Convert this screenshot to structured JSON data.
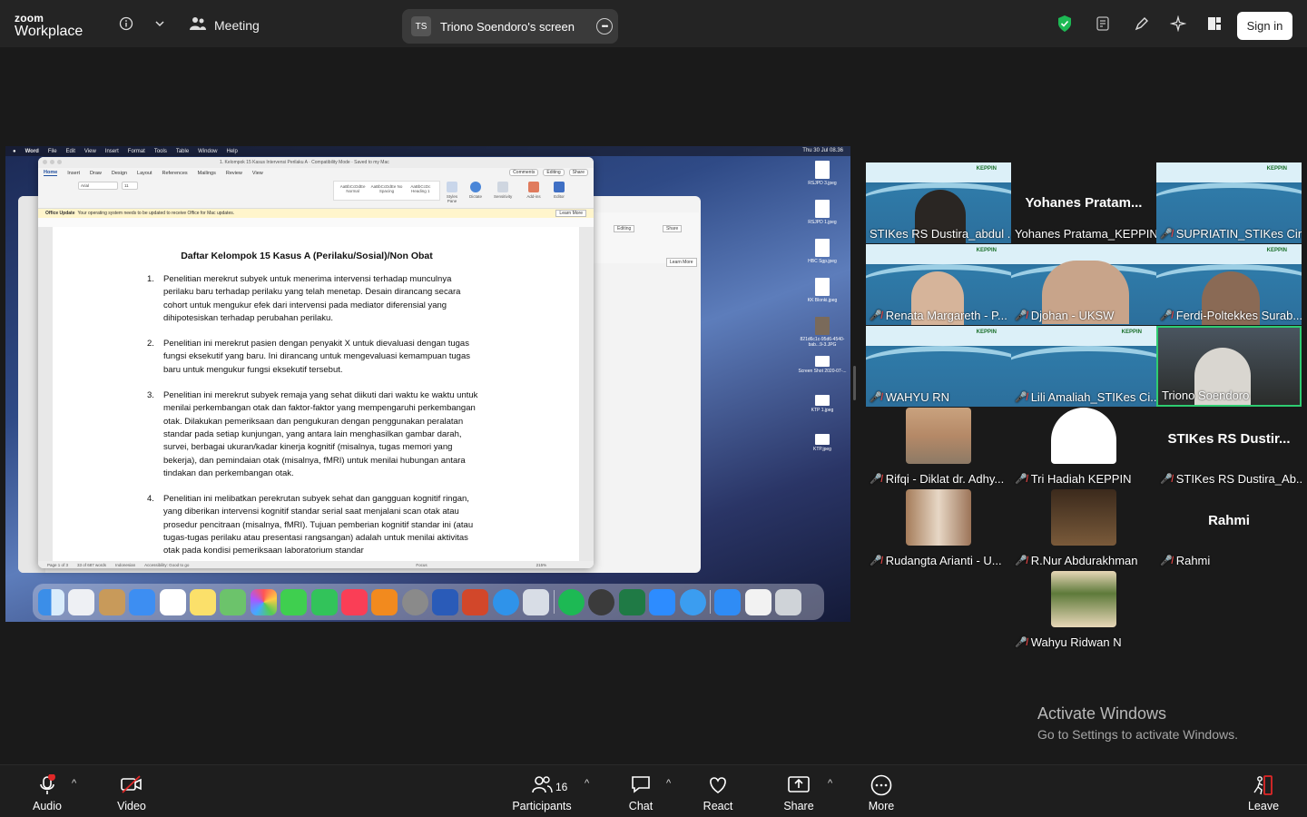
{
  "topbar": {
    "logo_line1": "zoom",
    "logo_line2": "Workplace",
    "meeting_label": "Meeting",
    "share_initials": "TS",
    "share_title": "Triono Soendoro's screen",
    "signin_label": "Sign in"
  },
  "shared_screen": {
    "menubar": [
      "Word",
      "File",
      "Edit",
      "View",
      "Insert",
      "Format",
      "Tools",
      "Table",
      "Window",
      "Help"
    ],
    "clock": "Thu 30 Jul  08.36",
    "word": {
      "doc_title_bar": "1. Kelompok 15 Kasus Intervensi Perilaku A  ·  Compatibility Mode  ·  Saved to my Mac",
      "tabs": [
        "Home",
        "Insert",
        "Draw",
        "Design",
        "Layout",
        "References",
        "Mailings",
        "Review",
        "View"
      ],
      "ribbon_buttons": [
        "Comments",
        "Editing",
        "Share"
      ],
      "font": "Arial",
      "font_size": "11",
      "styles": [
        "AaBbCcDdEe Normal",
        "AaBbCcDdEe No Spacing",
        "AaBbCcDc Heading 1"
      ],
      "ribbon_icons": [
        "Styles Pane",
        "Dictate",
        "Sensitivity",
        "Add-ins",
        "Editor"
      ],
      "notice_title": "Office Update",
      "notice_text": "Your operating system needs to be updated to receive Office for Mac updates.",
      "notice_button": "Learn More",
      "doc_heading": "Daftar Kelompok 15 Kasus A (Perilaku/Sosial)/Non Obat",
      "items": [
        "Penelitian merekrut subyek untuk menerima intervensi terhadap munculnya perilaku baru terhadap perilaku yang telah menetap. Desain dirancang secara cohort untuk mengukur efek dari intervensi pada mediator diferensial yang dihipotesiskan terhadap perubahan perilaku.",
        "Penelitian ini merekrut pasien dengan penyakit X untuk dievaluasi dengan tugas fungsi eksekutif yang baru. Ini dirancang untuk mengevaluasi kemampuan tugas baru untuk mengukur fungsi eksekutif tersebut.",
        "Penelitian ini merekrut subyek remaja yang sehat diikuti dari waktu ke waktu untuk menilai perkembangan otak dan faktor-faktor yang mempengaruhi perkembangan otak. Dilakukan pemeriksaan dan pengukuran dengan penggunakan peralatan standar pada setiap kunjungan, yang antara lain menghasilkan gambar darah, survei, berbagai ukuran/kadar kinerja kognitif (misalnya, tugas memori yang bekerja), dan pemindaian otak (misalnya, fMRI) untuk menilai hubungan antara tindakan dan perkembangan otak.",
        "Penelitian ini melibatkan perekrutan subyek sehat dan gangguan kognitif ringan, yang diberikan intervensi kognitif standar serial saat menjalani scan otak atau prosedur pencitraan (misalnya, fMRI). Tujuan pemberian kognitif standar ini (atau tugas-tugas perilaku atau presentasi rangsangan) adalah untuk menilai aktivitas otak pada kondisi pemeriksaan laboratorium standar"
      ],
      "status": [
        "Page 1 of 3",
        "33 of 687 words",
        "Indonesian",
        "Accessibility: Good to go",
        "Focus",
        "215%"
      ]
    },
    "background_window": {
      "buttons": [
        "Editing",
        "Share"
      ],
      "learn_more": "Learn More"
    },
    "desktop_files": [
      "RSJPD 3.jpeg",
      "RSJPD 1.jpeg",
      "HBC Sgp.jpeg",
      "KK Blonki.jpeg",
      "821d6c1c-95d6-4540-bab...9-3.JPG",
      "Screen Shot 2020-07-...",
      "KTP 1.jpeg",
      "KTP.jpeg"
    ]
  },
  "participants_grid": [
    {
      "name": "STIKes RS Dustira_abdul ...",
      "muted": false,
      "kind": "video"
    },
    {
      "name": "Yohanes Pratama_KEPPIN",
      "muted": false,
      "kind": "text",
      "big": "Yohanes  Pratam..."
    },
    {
      "name": "SUPRIATIN_STIKes Cir...",
      "muted": true,
      "kind": "bg"
    },
    {
      "name": "Renata Margareth - P...",
      "muted": true,
      "kind": "video"
    },
    {
      "name": "Djohan - UKSW",
      "muted": true,
      "kind": "video"
    },
    {
      "name": "Ferdi-Poltekkes Surab...",
      "muted": true,
      "kind": "video"
    },
    {
      "name": "WAHYU RN",
      "muted": true,
      "kind": "bg"
    },
    {
      "name": "Lili Amaliah_STIKes Ci...",
      "muted": true,
      "kind": "bg"
    },
    {
      "name": "Triono Soendoro",
      "muted": false,
      "kind": "video",
      "selected": true
    },
    {
      "name": "Rifqi - Diklat dr. Adhy...",
      "muted": true,
      "kind": "photo"
    },
    {
      "name": "Tri Hadiah KEPPIN",
      "muted": true,
      "kind": "photo"
    },
    {
      "name": "STIKes RS Dustira_Ab...",
      "muted": true,
      "kind": "text",
      "big": "STIKes RS Dustir..."
    },
    {
      "name": "Rudangta Arianti - U...",
      "muted": true,
      "kind": "photo"
    },
    {
      "name": "R.Nur Abdurakhman",
      "muted": true,
      "kind": "photo"
    },
    {
      "name": "Rahmi",
      "muted": true,
      "kind": "text",
      "big": "Rahmi"
    },
    {
      "name": "Wahyu Ridwan N",
      "muted": true,
      "kind": "photo"
    }
  ],
  "tile_badge": "KEPPIN",
  "activate_windows": {
    "line1": "Activate Windows",
    "line2": "Go to Settings to activate Windows."
  },
  "bottombar": {
    "audio": "Audio",
    "video": "Video",
    "participants": "Participants",
    "participants_count": "16",
    "chat": "Chat",
    "react": "React",
    "share": "Share",
    "more": "More",
    "leave": "Leave"
  },
  "colors": {
    "accent_green": "#2ecc71",
    "muted_red": "#e24646",
    "shield_green": "#1db954",
    "leave_red": "#e02828"
  }
}
